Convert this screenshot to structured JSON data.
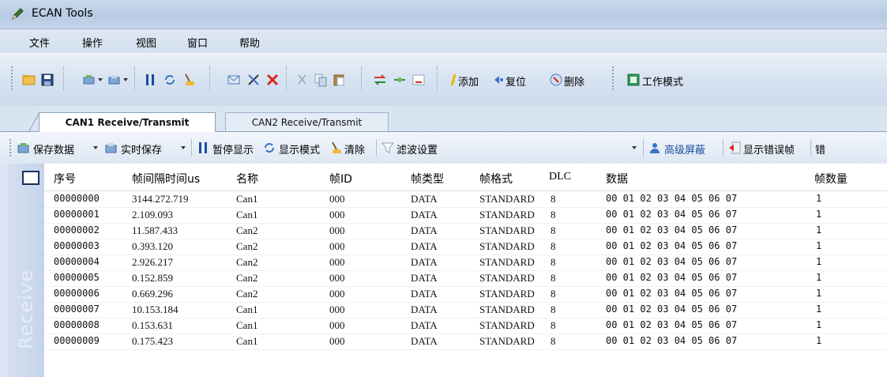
{
  "window": {
    "title": "ECAN Tools"
  },
  "menu": [
    "文件",
    "操作",
    "视图",
    "窗口",
    "帮助"
  ],
  "toolbar": {
    "add": "添加",
    "reset": "复位",
    "delete": "删除",
    "work_mode": "工作模式"
  },
  "tabs": {
    "active": "CAN1 Receive/Transmit",
    "inactive": "CAN2 Receive/Transmit"
  },
  "subtoolbar": {
    "save_data": "保存数据",
    "realtime_save": "实时保存",
    "pause_display": "暂停显示",
    "display_mode": "显示模式",
    "clear": "清除",
    "filter_settings": "滤波设置",
    "advanced_mask": "高级屏蔽",
    "show_error_frames": "显示错误帧",
    "truncated": "错"
  },
  "side_label": "Receive",
  "colors": {
    "accent": "#1b4a9c",
    "titlebar": "#b6cbe3"
  },
  "table": {
    "headers": [
      "序号",
      "帧间隔时间us",
      "名称",
      "帧ID",
      "帧类型",
      "帧格式",
      "DLC",
      "数据",
      "帧数量"
    ],
    "rows": [
      [
        "00000000",
        "3144.272.719",
        "Can1",
        "000",
        "DATA",
        "STANDARD",
        "8",
        "00 01 02 03 04 05 06 07",
        "1"
      ],
      [
        "00000001",
        "2.109.093",
        "Can1",
        "000",
        "DATA",
        "STANDARD",
        "8",
        "00 01 02 03 04 05 06 07",
        "1"
      ],
      [
        "00000002",
        "11.587.433",
        "Can2",
        "000",
        "DATA",
        "STANDARD",
        "8",
        "00 01 02 03 04 05 06 07",
        "1"
      ],
      [
        "00000003",
        "0.393.120",
        "Can2",
        "000",
        "DATA",
        "STANDARD",
        "8",
        "00 01 02 03 04 05 06 07",
        "1"
      ],
      [
        "00000004",
        "2.926.217",
        "Can2",
        "000",
        "DATA",
        "STANDARD",
        "8",
        "00 01 02 03 04 05 06 07",
        "1"
      ],
      [
        "00000005",
        "0.152.859",
        "Can2",
        "000",
        "DATA",
        "STANDARD",
        "8",
        "00 01 02 03 04 05 06 07",
        "1"
      ],
      [
        "00000006",
        "0.669.296",
        "Can2",
        "000",
        "DATA",
        "STANDARD",
        "8",
        "00 01 02 03 04 05 06 07",
        "1"
      ],
      [
        "00000007",
        "10.153.184",
        "Can1",
        "000",
        "DATA",
        "STANDARD",
        "8",
        "00 01 02 03 04 05 06 07",
        "1"
      ],
      [
        "00000008",
        "0.153.631",
        "Can1",
        "000",
        "DATA",
        "STANDARD",
        "8",
        "00 01 02 03 04 05 06 07",
        "1"
      ],
      [
        "00000009",
        "0.175.423",
        "Can1",
        "000",
        "DATA",
        "STANDARD",
        "8",
        "00 01 02 03 04 05 06 07",
        "1"
      ]
    ]
  }
}
